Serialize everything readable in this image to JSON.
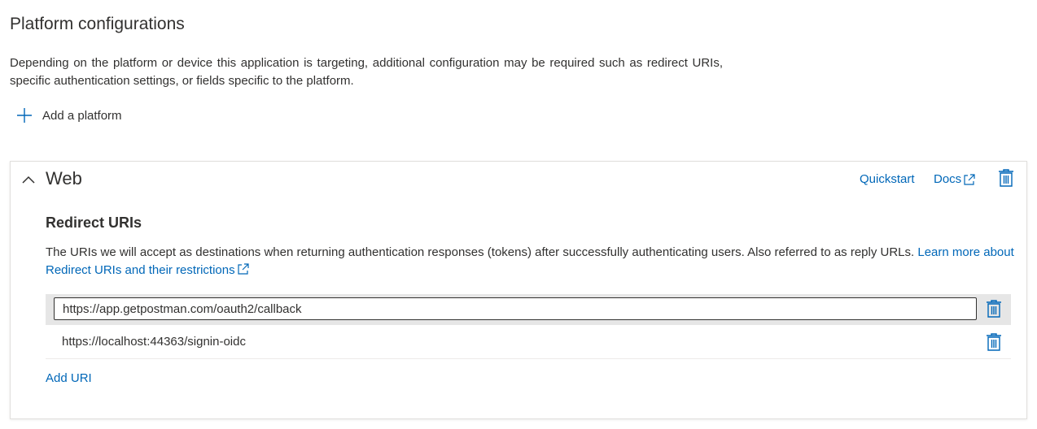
{
  "page": {
    "title": "Platform configurations",
    "description": "Depending on the platform or device this application is targeting, additional configuration may be required such as redirect URIs, specific authentication settings, or fields specific to the platform.",
    "add_platform_label": "Add a platform"
  },
  "web": {
    "title": "Web",
    "quickstart_label": "Quickstart",
    "docs_label": "Docs",
    "redirect_title": "Redirect URIs",
    "redirect_description": "The URIs we will accept as destinations when returning authentication responses (tokens) after successfully authenticating users. Also referred to as reply URLs. ",
    "learn_more_label": "Learn more about Redirect URIs and their restrictions",
    "uris": [
      {
        "value": "https://app.getpostman.com/oauth2/callback",
        "editing": true
      },
      {
        "value": "https://localhost:44363/signin-oidc",
        "editing": false
      }
    ],
    "add_uri_label": "Add URI"
  },
  "colors": {
    "accent": "#0067b8",
    "text": "#323130",
    "row_highlight": "#e6e6e6",
    "border": "#e1dfdd"
  },
  "icons": {
    "add": "plus-icon",
    "collapse": "chevron-up-icon",
    "external": "external-link-icon",
    "delete": "trash-icon"
  }
}
